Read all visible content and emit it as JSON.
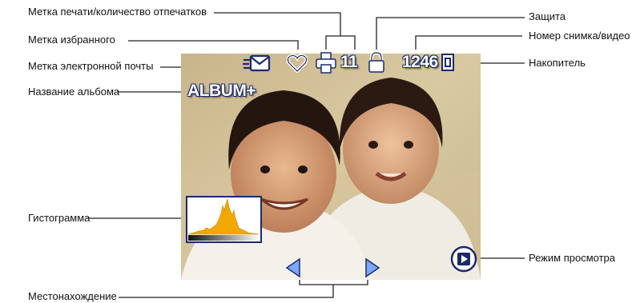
{
  "callouts": {
    "print_tag": "Метка печати/количество отпечатков",
    "favorite_tag": "Метка избранного",
    "email_tag": "Метка электронной почты",
    "album_name": "Название альбома",
    "histogram": "Гистограмма",
    "location": "Местонахождение",
    "protection": "Защита",
    "picture_video_number": "Номер снимка/видео",
    "storage": "Накопитель",
    "review_mode": "Режим просмотра"
  },
  "screen": {
    "print_count": "11",
    "picture_number": "1246",
    "album_label": "ALBUM+"
  },
  "icons": {
    "email": "email-tag-icon",
    "favorite": "heart-icon",
    "print": "printer-icon",
    "protect": "lock-icon",
    "storage": "memory-card-icon",
    "histogram": "histogram-icon",
    "prev": "left-arrow-icon",
    "next": "right-arrow-icon",
    "review": "play-review-icon"
  },
  "colors": {
    "icon_fill": "#ffffff",
    "icon_outline": "#1b2a6b",
    "arrow_fill": "#7aa7ff",
    "histogram_fill": "#f2a800"
  }
}
